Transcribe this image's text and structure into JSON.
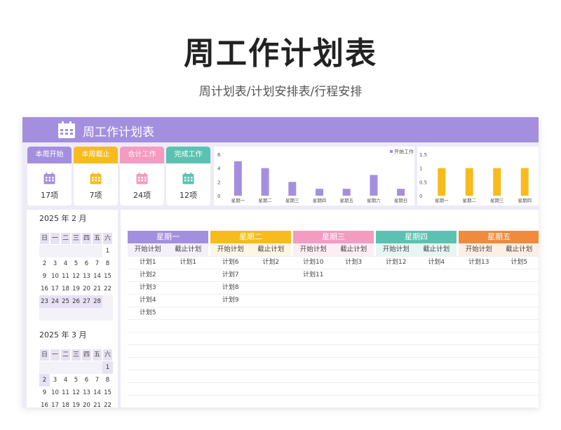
{
  "title": "周工作计划表",
  "subtitle": "周计划表/计划安排表/行程安排",
  "sheet": {
    "header_title": "周工作计划表"
  },
  "colors": {
    "purple": "#a48fdf",
    "yellow": "#f7bb1d",
    "pink": "#f59ac0",
    "teal": "#5bc2b1",
    "orange": "#f08a3c"
  },
  "stats": [
    {
      "label": "本周开始",
      "value": "17项",
      "color": "#a48fdf",
      "icon": "calendar-icon"
    },
    {
      "label": "本周截止",
      "value": "7项",
      "color": "#f7bb1d",
      "icon": "calendar-icon"
    },
    {
      "label": "合计工作",
      "value": "24项",
      "color": "#f59ac0",
      "icon": "calendar-icon"
    },
    {
      "label": "完成工作",
      "value": "12项",
      "color": "#5bc2b1",
      "icon": "calendar-icon"
    }
  ],
  "chart_data": [
    {
      "type": "bar",
      "legend": "开始工作",
      "categories": [
        "星期一",
        "星期二",
        "星期三",
        "星期四",
        "星期五",
        "星期六",
        "星期日"
      ],
      "values": [
        5,
        4,
        2,
        1,
        1,
        3,
        1
      ],
      "ylim": [
        0,
        6
      ],
      "yticks": [
        "0",
        "2",
        "4",
        "6"
      ],
      "color": "#a48fdf"
    },
    {
      "type": "bar",
      "categories": [
        "星期一",
        "星期二",
        "星期三",
        "星期四"
      ],
      "values": [
        1,
        1,
        1,
        1
      ],
      "ylim": [
        0,
        1.5
      ],
      "yticks": [
        "0",
        "0.5",
        "1",
        "1.5"
      ],
      "color": "#f7bb1d"
    }
  ],
  "calendars": [
    {
      "year": "2025",
      "year_unit": "年",
      "month": "2",
      "month_unit": "月",
      "weekdays": [
        "日",
        "一",
        "二",
        "三",
        "四",
        "五",
        "六"
      ],
      "rows": [
        [
          "",
          "",
          "",
          "",
          "",
          "",
          "1"
        ],
        [
          "2",
          "3",
          "4",
          "5",
          "6",
          "7",
          "8"
        ],
        [
          "9",
          "10",
          "11",
          "12",
          "13",
          "14",
          "15"
        ],
        [
          "16",
          "17",
          "18",
          "19",
          "20",
          "21",
          "22"
        ],
        [
          "23",
          "24",
          "25",
          "26",
          "27",
          "28",
          ""
        ],
        [
          "",
          "",
          "",
          "",
          "",
          "",
          ""
        ]
      ]
    },
    {
      "year": "2025",
      "year_unit": "年",
      "month": "3",
      "month_unit": "月",
      "weekdays": [
        "日",
        "一",
        "二",
        "三",
        "四",
        "五",
        "六"
      ],
      "rows": [
        [
          "",
          "",
          "",
          "",
          "",
          "",
          "1"
        ],
        [
          "2",
          "3",
          "4",
          "5",
          "6",
          "7",
          "8"
        ],
        [
          "9",
          "10",
          "11",
          "12",
          "13",
          "14",
          "15"
        ],
        [
          "16",
          "17",
          "18",
          "19",
          "20",
          "21",
          "22"
        ]
      ]
    }
  ],
  "week": {
    "start_label": "开始计划",
    "end_label": "截止计划",
    "days": [
      {
        "name": "星期一",
        "color": "#a48fdf",
        "sub_bg": "#f3f0fa",
        "start": [
          "计划1",
          "计划2",
          "计划3",
          "计划4",
          "计划5"
        ],
        "end": [
          "计划1"
        ]
      },
      {
        "name": "星期二",
        "color": "#f7bb1d",
        "sub_bg": "#fdf6e3",
        "start": [
          "计划6",
          "计划7",
          "计划8",
          "计划9"
        ],
        "end": [
          "计划2"
        ]
      },
      {
        "name": "星期三",
        "color": "#f59ac0",
        "sub_bg": "#fdeef4",
        "start": [
          "计划10",
          "计划11"
        ],
        "end": [
          "计划3"
        ]
      },
      {
        "name": "星期四",
        "color": "#5bc2b1",
        "sub_bg": "#e8f6f3",
        "start": [
          "计划12"
        ],
        "end": [
          "计划4"
        ]
      },
      {
        "name": "星期五",
        "color": "#f08a3c",
        "sub_bg": "#fdefe4",
        "start": [
          "计划13"
        ],
        "end": [
          "计划5"
        ]
      }
    ]
  }
}
